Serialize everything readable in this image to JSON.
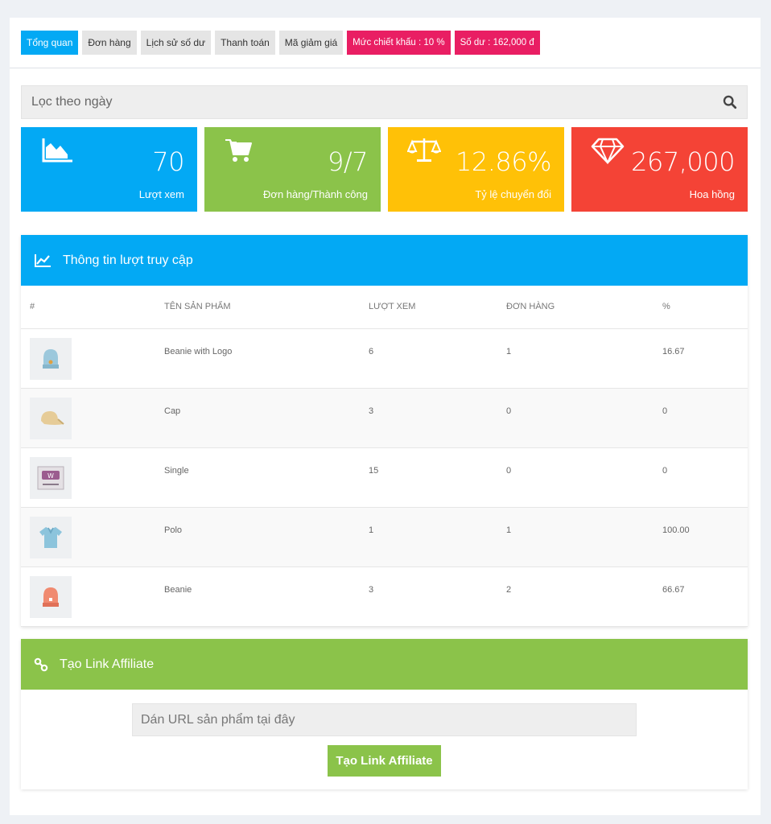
{
  "tabs": [
    {
      "label": "Tổng quan"
    },
    {
      "label": "Đơn hàng"
    },
    {
      "label": "Lịch sử số dư"
    },
    {
      "label": "Thanh toán"
    },
    {
      "label": "Mã giảm giá"
    }
  ],
  "badges": {
    "discount": "Mức chiết khấu : 10 %",
    "balance": "Số dư : 162,000 đ"
  },
  "filter": {
    "placeholder": "Lọc theo ngày"
  },
  "stats": [
    {
      "value": "70",
      "label": "Lượt xem",
      "color": "#03a9f4",
      "icon": "area-chart-icon"
    },
    {
      "value": "9/7",
      "label": "Đơn hàng/Thành công",
      "color": "#8bc34a",
      "icon": "cart-icon"
    },
    {
      "value": "12.86%",
      "label": "Tỷ lệ chuyển đổi",
      "color": "#ffc107",
      "icon": "balance-scale-icon"
    },
    {
      "value": "267,000",
      "label": "Hoa hồng",
      "color": "#f44336",
      "icon": "diamond-icon"
    }
  ],
  "traffic": {
    "title": "Thông tin lượt truy cập",
    "columns": [
      "#",
      "Tên sản phẩm",
      "Lượt xem",
      "Đơn hàng",
      "%"
    ],
    "rows": [
      {
        "name": "Beanie with Logo",
        "views": "6",
        "orders": "1",
        "percent": "16.67",
        "thumb": "beanie-logo"
      },
      {
        "name": "Cap",
        "views": "3",
        "orders": "0",
        "percent": "0",
        "thumb": "cap"
      },
      {
        "name": "Single",
        "views": "15",
        "orders": "0",
        "percent": "0",
        "thumb": "single"
      },
      {
        "name": "Polo",
        "views": "1",
        "orders": "1",
        "percent": "100.00",
        "thumb": "polo"
      },
      {
        "name": "Beanie",
        "views": "3",
        "orders": "2",
        "percent": "66.67",
        "thumb": "beanie"
      }
    ]
  },
  "affiliate": {
    "title": "Tạo Link Affiliate",
    "input_placeholder": "Dán URL sản phẩm tại đây",
    "button_label": "Tạo Link Affiliate"
  }
}
